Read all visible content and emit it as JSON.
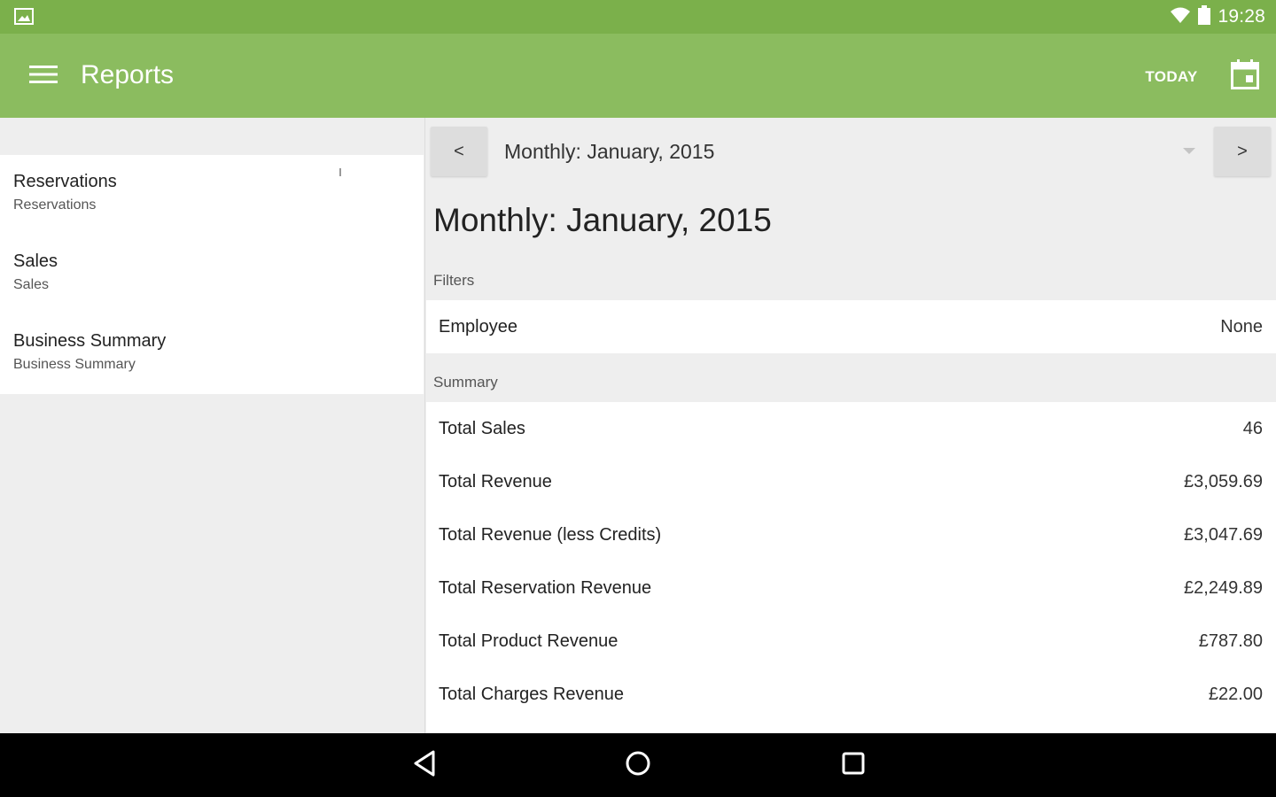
{
  "status_bar": {
    "time": "19:28",
    "left_icon": "image-notification-icon",
    "wifi_icon": "wifi-icon",
    "battery_icon": "battery-icon"
  },
  "app_bar": {
    "title": "Reports",
    "today_label": "TODAY",
    "menu_icon": "hamburger-menu-icon",
    "calendar_icon": "calendar-icon"
  },
  "reports": [
    {
      "title": "Reservations",
      "subtitle": "Reservations"
    },
    {
      "title": "Sales",
      "subtitle": "Sales"
    },
    {
      "title": "Business Summary",
      "subtitle": "Business Summary"
    }
  ],
  "period": {
    "prev_label": "<",
    "next_label": ">",
    "selected": "Monthly: January, 2015"
  },
  "report": {
    "heading": "Monthly: January, 2015",
    "filters_label": "Filters",
    "filters": [
      {
        "label": "Employee",
        "value": "None"
      }
    ],
    "summary_label": "Summary",
    "summary": [
      {
        "label": "Total Sales",
        "value": "46"
      },
      {
        "label": "Total Revenue",
        "value": "£3,059.69"
      },
      {
        "label": "Total Revenue (less Credits)",
        "value": "£3,047.69"
      },
      {
        "label": "Total Reservation Revenue",
        "value": "£2,249.89"
      },
      {
        "label": "Total Product Revenue",
        "value": "£787.80"
      },
      {
        "label": "Total Charges Revenue",
        "value": "£22.00"
      }
    ]
  },
  "colors": {
    "status_bar": "#7bb04b",
    "app_bar": "#8bbc5f",
    "background": "#eeeeee",
    "nav_bar": "#000000"
  }
}
